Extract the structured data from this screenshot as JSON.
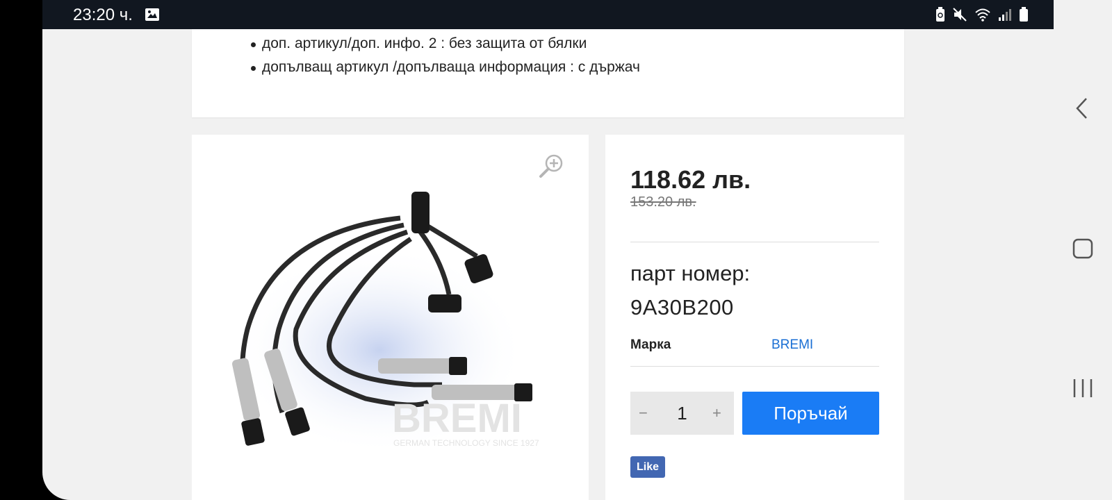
{
  "status_bar": {
    "time": "23:20 ч.",
    "icons": [
      "image-icon",
      "battery-saver-icon",
      "mute-icon",
      "wifi-icon",
      "signal-icon",
      "battery-icon"
    ]
  },
  "details": {
    "bullets": [
      "доп. артикул/доп. инфо. 2 : без защита от бялки",
      "допълващ артикул /допълваща информация : с държач"
    ]
  },
  "product": {
    "image_watermark": "BREMI",
    "image_watermark_sub": "GERMAN TECHNOLOGY SINCE 1927",
    "price": "118.62 лв.",
    "old_price": "153.20 лв.",
    "part_label": "парт номер:",
    "part_number": "9A30B200",
    "brand_label": "Марка",
    "brand_value": "BREMI",
    "quantity": "1",
    "qty_minus": "−",
    "qty_plus": "+",
    "order_label": "Поръчай",
    "like_label": "Like"
  },
  "colors": {
    "accent": "#1a7cf5",
    "brand_link": "#1a6fd4",
    "like": "#4267b2"
  },
  "nav_icons": [
    "back-icon",
    "home-icon",
    "recent-apps-icon"
  ]
}
